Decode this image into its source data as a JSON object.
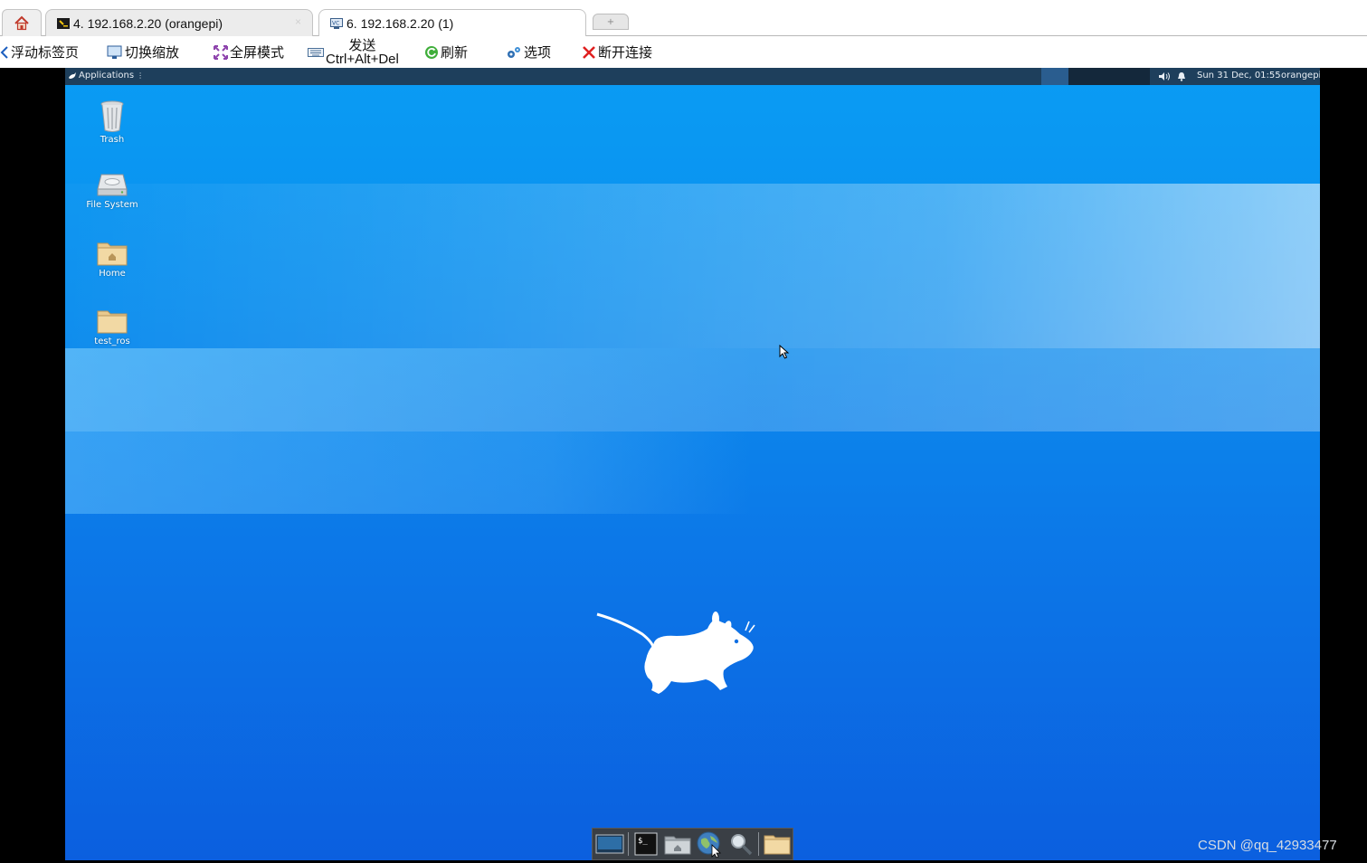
{
  "tabs": {
    "home_icon": "home-icon",
    "items": [
      {
        "label": "4. 192.168.2.20 (orangepi)",
        "icon": "ssh-terminal-icon",
        "close": "×"
      },
      {
        "label": "6. 192.168.2.20 (1)",
        "icon": "vnc-icon"
      }
    ],
    "new_tab_symbol": "+"
  },
  "toolbar": {
    "float_tabs": "浮动标签页",
    "switch_zoom": "切换缩放",
    "fullscreen": "全屏模式",
    "send_line1": "发送",
    "send_line2": "Ctrl+Alt+Del",
    "refresh": "刷新",
    "options": "选项",
    "disconnect": "断开连接"
  },
  "panel": {
    "applications": "Applications",
    "datetime": "Sun 31 Dec, 01:55",
    "user": "orangepi",
    "colors": {
      "panel": "#1e3f5c",
      "workspace_active": "#2a5d8f"
    }
  },
  "desktop": {
    "icons": [
      {
        "label": "Trash",
        "icon": "trash-icon"
      },
      {
        "label": "File System",
        "icon": "drive-icon"
      },
      {
        "label": "Home",
        "icon": "home-folder-icon"
      },
      {
        "label": "test_ros",
        "icon": "folder-icon"
      }
    ]
  },
  "dock": {
    "items": [
      "show-desktop-icon",
      "terminal-icon",
      "file-manager-icon",
      "web-browser-icon",
      "app-finder-icon",
      "folder-icon"
    ]
  },
  "watermark": "CSDN @qq_42933477"
}
